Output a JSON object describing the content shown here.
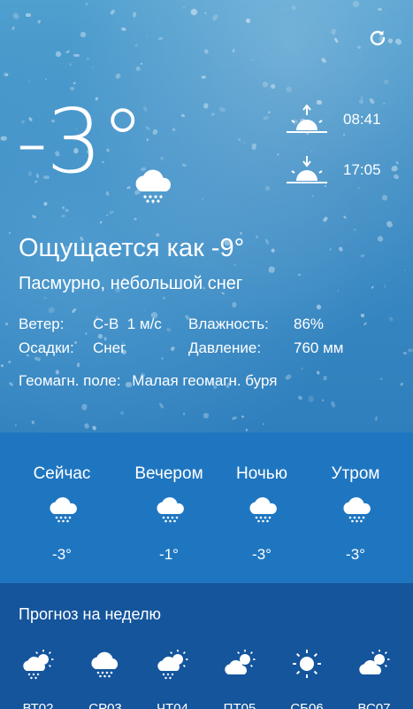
{
  "current": {
    "temperature": "-3°",
    "condition_icon": "snow-cloud-icon",
    "feels_like": "Ощущается как -9°",
    "description": "Пасмурно, небольшой снег",
    "sunrise": "08:41",
    "sunset": "17:05",
    "details": {
      "wind_label": "Ветер:",
      "wind_value": "С-В  1 м/с",
      "humidity_label": "Влажность:",
      "humidity_value": "86%",
      "precip_label": "Осадки:",
      "precip_value": "Снег",
      "pressure_label": "Давление:",
      "pressure_value": "760 мм"
    },
    "geomag_label": "Геомагн. поле:",
    "geomag_value": "Малая геомагн. буря"
  },
  "day_parts": [
    {
      "label": "Сейчас",
      "icon": "snow-cloud-icon",
      "temp": "-3°"
    },
    {
      "label": "Вечером",
      "icon": "snow-cloud-icon",
      "temp": "-1°"
    },
    {
      "label": "Ночью",
      "icon": "snow-cloud-icon",
      "temp": "-3°"
    },
    {
      "label": "Утром",
      "icon": "snow-cloud-icon",
      "temp": "-3°"
    }
  ],
  "week": {
    "title": "Прогноз на неделю",
    "days": [
      {
        "name": "ВТ02",
        "icon": "sun-cloud-snow-icon"
      },
      {
        "name": "СР03",
        "icon": "snow-cloud-icon"
      },
      {
        "name": "ЧТ04",
        "icon": "sun-cloud-snow-icon"
      },
      {
        "name": "ПТ05",
        "icon": "partly-cloudy-icon"
      },
      {
        "name": "СБ06",
        "icon": "sun-icon"
      },
      {
        "name": "ВС07",
        "icon": "partly-cloudy-icon"
      }
    ]
  },
  "colors": {
    "hero_top": "#4f9fcf",
    "day_parts_bg": "#1f76c0",
    "week_bg": "#14559c"
  }
}
